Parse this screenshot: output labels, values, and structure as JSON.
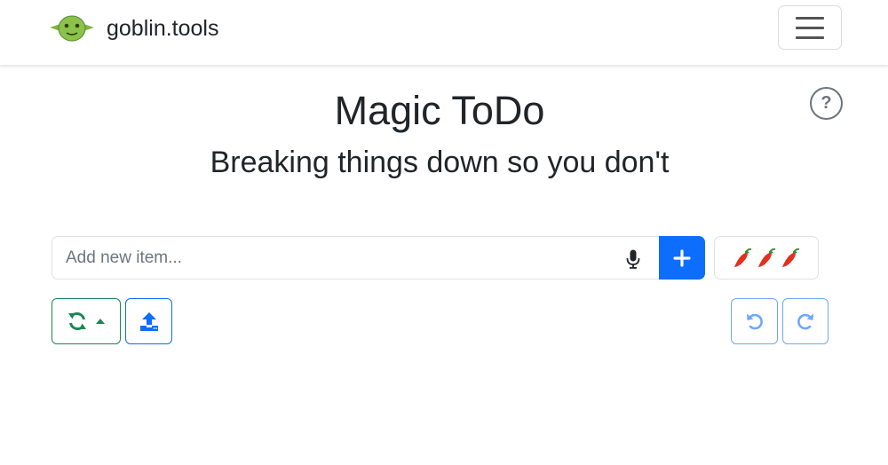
{
  "navbar": {
    "brand": "goblin.tools",
    "menu_icon": "hamburger-menu-icon"
  },
  "page": {
    "title": "Magic ToDo",
    "subtitle": "Breaking things down so you don't",
    "help_label": "?"
  },
  "todo_input": {
    "placeholder": "Add new item...",
    "value": "",
    "mic_icon": "microphone-icon",
    "add_icon": "plus-icon"
  },
  "spiciness": {
    "icon": "chili-pepper-icon",
    "level": 3
  },
  "toolbar": {
    "regenerate_icon": "sync-icon",
    "regenerate_dropdown_icon": "caret-up-icon",
    "export_icon": "upload-icon",
    "undo_icon": "undo-icon",
    "redo_icon": "redo-icon"
  },
  "colors": {
    "primary": "#0d6efd",
    "success": "#198754",
    "undo_redo": "#6ea8fe",
    "goblin_green": "#8bc34a"
  }
}
